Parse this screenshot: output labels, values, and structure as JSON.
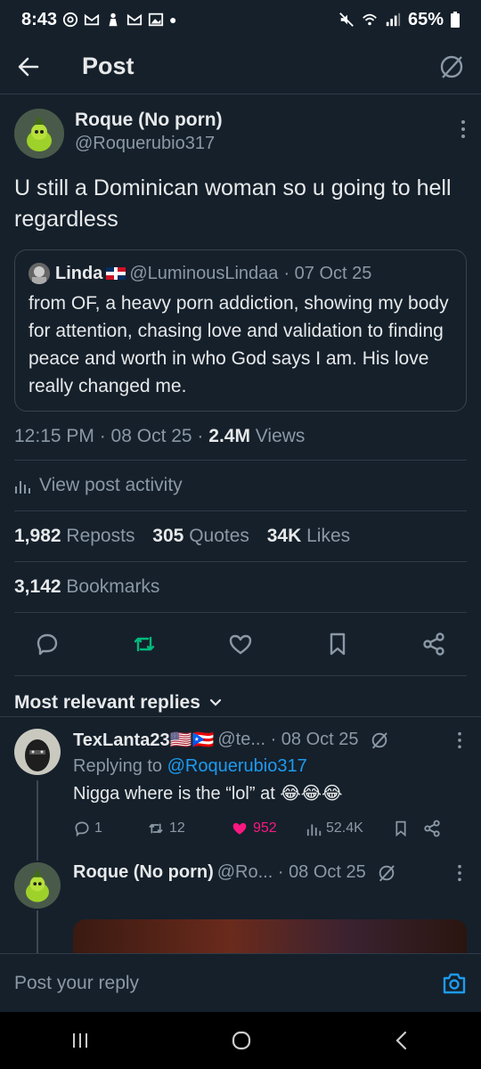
{
  "status_bar": {
    "time": "8:43",
    "battery": "65%"
  },
  "header": {
    "title": "Post"
  },
  "post": {
    "author_name": "Roque (No porn)",
    "author_handle": "@Roquerubio317",
    "text": "U still a Dominican woman so u going to hell regardless",
    "quote": {
      "name": "Linda",
      "handle": "@LuminousLindaa",
      "date": "· 07 Oct 25",
      "text": "from OF, a heavy porn addiction, showing my body for attention, chasing love and validation to finding peace and worth in who God says I am. His love really changed me."
    },
    "time": "12:15 PM · 08 Oct 25 · ",
    "views_count": "2.4M",
    "views_label": " Views",
    "activity_label": "View post activity",
    "reposts": "1,982",
    "reposts_label": "Reposts",
    "quotes": "305",
    "quotes_label": "Quotes",
    "likes": "34K",
    "likes_label": "Likes",
    "bookmarks": "3,142",
    "bookmarks_label": "Bookmarks"
  },
  "sort_label": "Most relevant replies",
  "replies": [
    {
      "name": "TexLanta23🇺🇸🇵🇷",
      "meta": "@te... · 08 Oct 25",
      "replying_prefix": "Replying to ",
      "replying_handle": "@Roquerubio317",
      "text": "Nigga where is the “lol” at 😂😂😂",
      "replies": "1",
      "reposts": "12",
      "likes": "952",
      "views": "52.4K"
    },
    {
      "name": "Roque (No porn)",
      "meta": "@Ro... · 08 Oct 25"
    }
  ],
  "compose_placeholder": "Post your reply",
  "colors": {
    "bg": "#15202b",
    "accent": "#1d9bf0",
    "like": "#f91880",
    "repost": "#00ba7c"
  }
}
